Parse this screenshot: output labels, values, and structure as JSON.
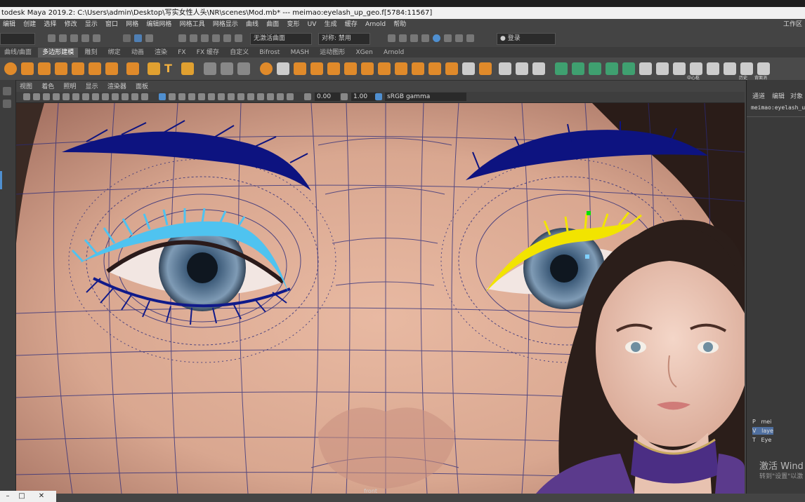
{
  "title_bar": {
    "text": "todesk Maya 2019.2: C:\\Users\\admin\\Desktop\\写实女性人头\\NR\\scenes\\Mod.mb*   ---   meimao:eyelash_up_geo.f[5784:11567]"
  },
  "main_menu": [
    "编辑",
    "创建",
    "选择",
    "修改",
    "显示",
    "窗口",
    "网格",
    "编辑网格",
    "网格工具",
    "网格显示",
    "曲线",
    "曲面",
    "变形",
    "UV",
    "生成",
    "缓存",
    "Arnold",
    "帮助"
  ],
  "workspace_label": "工作区",
  "status_line": {
    "selection_mode": "无激活曲面",
    "symmetry": "对称: 禁用",
    "login": "登录"
  },
  "shelf_tabs": [
    "曲线/曲面",
    "多边形建模",
    "雕刻",
    "绑定",
    "动画",
    "渲染",
    "FX",
    "FX 缓存",
    "自定义",
    "Bifrost",
    "MASH",
    "运动图形",
    "XGen",
    "Arnold"
  ],
  "active_shelf_tab": "多边形建模",
  "shelf_right_labels": [
    "中心枢",
    "历史",
    "背面消"
  ],
  "viewport": {
    "menu": [
      "视图",
      "着色",
      "照明",
      "显示",
      "渲染器",
      "面板"
    ],
    "exposure": "0.00",
    "gamma": "1.00",
    "color_space": "sRGB gamma",
    "camera_label": "front"
  },
  "right_panel": {
    "tabs": [
      "通道",
      "编辑",
      "对象"
    ],
    "node_name": "meimao:eyelash_u",
    "outliner_rows": [
      {
        "label": "P",
        "name": "mei"
      },
      {
        "label": "V",
        "name": "laye"
      },
      {
        "label": "T",
        "name": "Eye"
      }
    ],
    "activate_windows_title": "激活 Wind",
    "activate_windows_sub": "转到\"设置\"以激"
  },
  "colors": {
    "brow_color": "#0d1380",
    "lash_left_color": "#4fc3f0",
    "lash_right_color": "#f2e400",
    "wire_color": "#2a2a7a"
  }
}
